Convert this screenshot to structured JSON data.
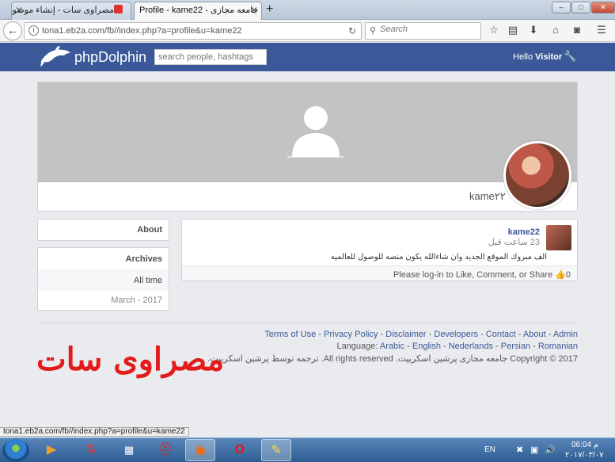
{
  "browser": {
    "tabs": [
      {
        "label": "مصراوی سات - إنشاء موضوع",
        "active": false
      },
      {
        "label": "Profile - kame22 - جامعه مجازی",
        "active": true
      }
    ],
    "new_tab": "+",
    "window_controls": [
      "–",
      "□",
      "✕"
    ],
    "url": "tona1.eb2a.com/fb//index.php?a=profile&u=kame22",
    "search_placeholder": "Search"
  },
  "site": {
    "logo": "phpDolphin",
    "search_placeholder": "search people, hashtags",
    "greeting": "Hello",
    "user": "Visitor"
  },
  "profile": {
    "name": "kame۲۲"
  },
  "sidebar": {
    "about": "About",
    "archives": "Archives",
    "archive_items": [
      "All time",
      "March - 2017"
    ]
  },
  "post": {
    "author": "kame22",
    "time": "23 ساعت قبل",
    "text": "الف مبروك الموقع الجديد وان شاءالله يكون منصه للوصول للعالميه",
    "footer": "Please log-in to Like, Comment, or Share",
    "likes": "0"
  },
  "footer": {
    "links": [
      "Terms of Use",
      "Privacy Policy",
      "Disclaimer",
      "Developers",
      "Contact",
      "About",
      "Admin"
    ],
    "language_label": "Language:",
    "languages": [
      "Arabic",
      "English",
      "Nederlands",
      "Persian",
      "Romanian"
    ],
    "copyright": "Copyright © 2017 جامعه مجازی پرشین اسکریپت. All rights reserved. ترجمه توسط پرشین اسکریپت."
  },
  "brand_text": "مصراوی سات",
  "status_url": "tona1.eb2a.com/fb//index.php?a=profile&u=kame22",
  "taskbar": {
    "lang": "EN",
    "time": "06:04 م",
    "date": "٢٠١٧/٠٣/٠٧"
  },
  "colors": {
    "header": "#3b5998",
    "brand": "#e31b1b"
  }
}
